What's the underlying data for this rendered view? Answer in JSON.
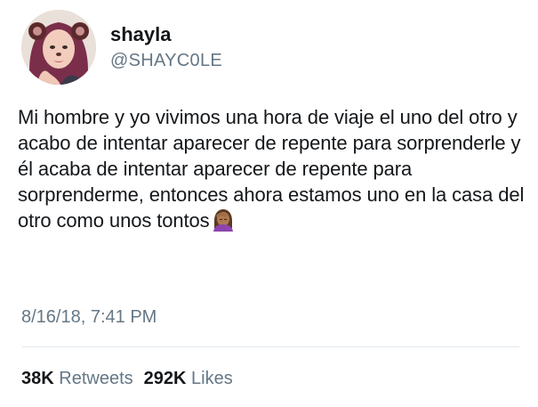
{
  "user": {
    "display_name": "shayla",
    "handle": "@SHAYC0LE"
  },
  "tweet": {
    "text": "Mi hombre y yo vivimos una hora de viaje el uno del otro y acabo de intentar aparecer de repente para sorprenderle y él acaba de intentar aparecer de repente para sorprenderme, entonces ahora estamos uno en la casa del otro como unos tontos",
    "emoji": "face-palm-emoji",
    "timestamp": "8/16/18, 7:41 PM"
  },
  "stats": {
    "retweets_count": "38K",
    "retweets_label": "Retweets",
    "likes_count": "292K",
    "likes_label": "Likes"
  },
  "colors": {
    "text_primary": "#14171a",
    "text_secondary": "#657786",
    "divider": "#e1e8ed"
  }
}
